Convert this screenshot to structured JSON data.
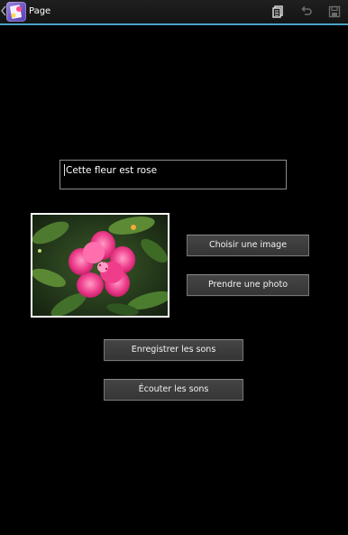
{
  "action_bar": {
    "title": "Page",
    "icons": {
      "up": "chevron-left-icon",
      "app": "app-icon",
      "copy": "copy-icon",
      "undo": "undo-icon",
      "save": "save-icon"
    },
    "accent_color": "#4aa3c8"
  },
  "form": {
    "text_value": "Cette fleur est rose"
  },
  "buttons": {
    "choose_image": "Choisir une image",
    "take_photo": "Prendre une photo",
    "record_sounds": "Enregistrer les sons",
    "listen_sounds": "Écouter les sons"
  },
  "image": {
    "subject": "pink-flower-photo"
  },
  "colors": {
    "background": "#000000",
    "button_bg": "#3d3d3d",
    "field_border": "#8c8c8c"
  }
}
